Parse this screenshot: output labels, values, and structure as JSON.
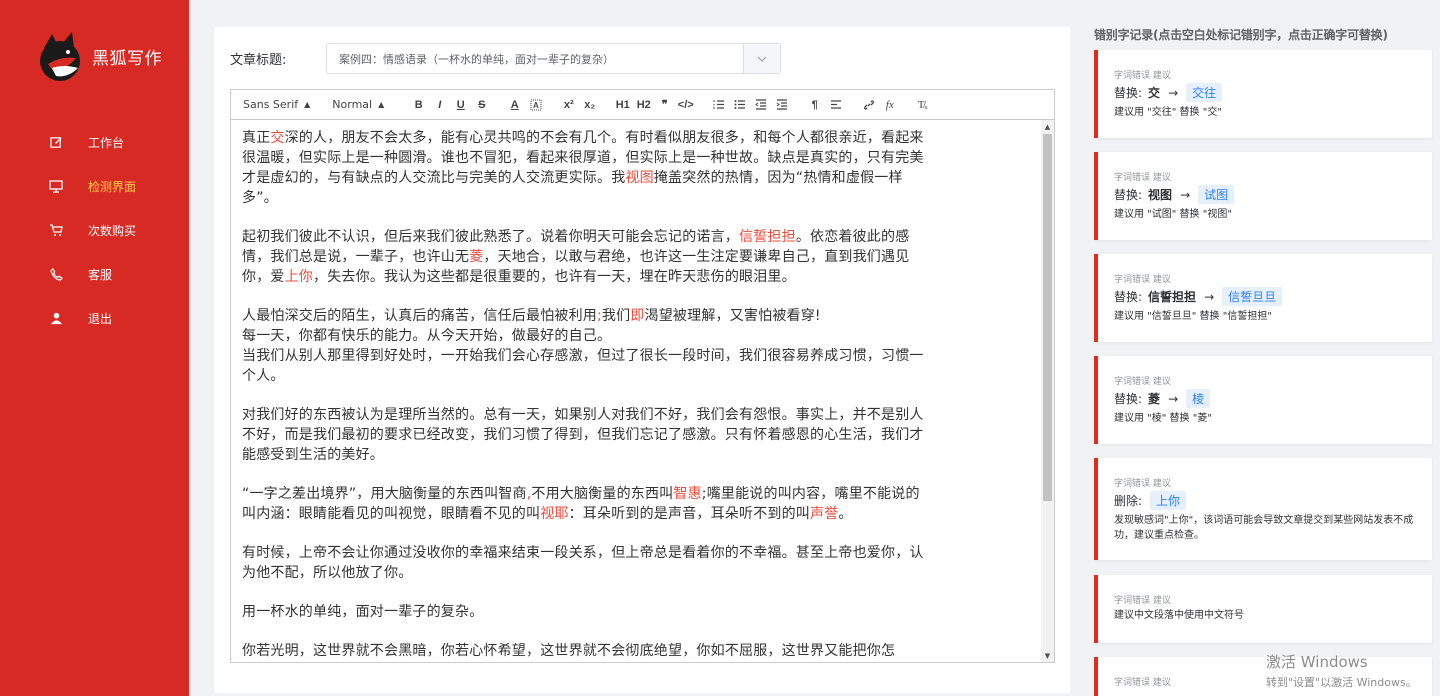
{
  "app": {
    "name": "黑狐写作"
  },
  "nav": [
    {
      "label": "工作台",
      "icon": "edit-icon",
      "active": false
    },
    {
      "label": "检测界面",
      "icon": "monitor-icon",
      "active": true
    },
    {
      "label": "次数购买",
      "icon": "cart-icon",
      "active": false
    },
    {
      "label": "客服",
      "icon": "phone-icon",
      "active": false
    },
    {
      "label": "退出",
      "icon": "user-icon",
      "active": false
    }
  ],
  "article": {
    "title_label": "文章标题:",
    "title_value": "案例四：情感语录（一杯水的单纯，面对一辈子的复杂）"
  },
  "toolbar": {
    "font": "Sans Serif",
    "size": "Normal"
  },
  "editor": {
    "lines": [
      [
        [
          "真正",
          0
        ],
        [
          "交",
          1
        ],
        [
          "深的人，朋友不会太多，能有心灵共鸣的不会有几个。有时看似朋友很多，和每个人都很亲近，看起来",
          0
        ]
      ],
      [
        [
          "很温暖，但实际上是一种圆滑。谁也不冒犯，看起来很厚道，但实际上是一种世故。缺点是真实的，只有完美",
          0
        ]
      ],
      [
        [
          "才是虚幻的，与有缺点的人交流比与完美的人交流更实际。我",
          0
        ],
        [
          "视图",
          1
        ],
        [
          "掩盖突然的热情，因为“热情和虚假一样",
          0
        ]
      ],
      [
        [
          "多”。",
          0
        ]
      ],
      [],
      [
        [
          "起初我们彼此不认识，但后来我们彼此熟悉了。说着你明天可能会忘记的诺言，",
          0
        ],
        [
          "信誓担担",
          1
        ],
        [
          "。依恋着彼此的感",
          0
        ]
      ],
      [
        [
          "情，我们总是说，一辈子，也许山无",
          0
        ],
        [
          "菱",
          1
        ],
        [
          "，天地合，以敢与君绝，也许这一生注定要谦卑自己，直到我们遇见",
          0
        ]
      ],
      [
        [
          "你，爱",
          0
        ],
        [
          "上你",
          1
        ],
        [
          "，失去你。我认为这些都是很重要的，也许有一天，埋在昨天悲伤的眼泪里。",
          0
        ]
      ],
      [],
      [
        [
          "人最怕深交后的陌生，认真后的痛苦，信任后最怕被利用",
          0
        ],
        [
          ";",
          1
        ],
        [
          "我们",
          0
        ],
        [
          "即",
          1
        ],
        [
          "渴望被理解，又害怕被看穿!",
          0
        ]
      ],
      [
        [
          "每一天，你都有快乐的能力。从今天开始，做最好的自己。",
          0
        ]
      ],
      [
        [
          "当我们从别人那里得到好处时，一开始我们会心存感激，但过了很长一段时间，我们很容易养成习惯，习惯一",
          0
        ]
      ],
      [
        [
          "个人。",
          0
        ]
      ],
      [],
      [
        [
          "对我们好的东西被认为是理所当然的。总有一天，如果别人对我们不好，我们会有怨恨。事实上，并不是别人",
          0
        ]
      ],
      [
        [
          "不好，而是我们最初的要求已经改变，我们习惯了得到，但我们忘记了感激。只有怀着感恩的心生活，我们才",
          0
        ]
      ],
      [
        [
          "能感受到生活的美好。",
          0
        ]
      ],
      [],
      [
        [
          "“一字之差出境界”，用大脑衡量的东西叫智商",
          0
        ],
        [
          ",",
          1
        ],
        [
          "不用大脑衡量的东西叫",
          0
        ],
        [
          "智惠",
          1
        ],
        [
          ";嘴里能说的叫内容，嘴里不能说的",
          0
        ]
      ],
      [
        [
          "叫内涵：眼睛能看见的叫视觉，眼睛看不见的叫",
          0
        ],
        [
          "视耶",
          1
        ],
        [
          "：耳朵听到的是声音，耳朵听不到的叫",
          0
        ],
        [
          "声誉",
          1
        ],
        [
          "。",
          0
        ]
      ],
      [],
      [
        [
          "有时候，上帝不会让你通过没收你的幸福来结束一段关系，但上帝总是看着你的不幸福。甚至上帝也爱你，认",
          0
        ]
      ],
      [
        [
          "为他不配，所以他放了你。",
          0
        ]
      ],
      [],
      [
        [
          "用一杯水的单纯，面对一辈子的复杂。",
          0
        ]
      ],
      [],
      [
        [
          "你若光明，这世界就不会黑暗，你若心怀希望，这世界就不会彻底绝望，你如不屈服，这世界又能把你怎",
          0
        ]
      ]
    ]
  },
  "panel": {
    "title": "错别字记录(点击空白处标记错别字，点击正确字可替换)",
    "cards": [
      {
        "type": "字词错误 建议",
        "action": "替换:",
        "orig": "交",
        "suggest": "交往",
        "desc": "建议用 \"交往\" 替换 \"交\""
      },
      {
        "type": "字词错误 建议",
        "action": "替换:",
        "orig": "视图",
        "suggest": "试图",
        "desc": "建议用 \"试图\" 替换 \"视图\""
      },
      {
        "type": "字词错误 建议",
        "action": "替换:",
        "orig": "信誓担担",
        "suggest": "信誓旦旦",
        "desc": "建议用 \"信誓旦旦\" 替换 \"信誓担担\""
      },
      {
        "type": "字词错误 建议",
        "action": "替换:",
        "orig": "菱",
        "suggest": "棱",
        "desc": "建议用 \"棱\" 替换 \"菱\""
      },
      {
        "type": "字词错误 建议",
        "action": "删除:",
        "orig": "",
        "suggest": "上你",
        "desc": "发现敏感词\"上你\"，该词语可能会导致文章提交到某些网站发表不成功，建议重点检查。"
      },
      {
        "type": "字词错误 建议",
        "action": "",
        "orig": "",
        "suggest": "",
        "desc": "建议中文段落中使用中文符号"
      },
      {
        "type": "字词错误 建议",
        "action": "",
        "orig": "",
        "suggest": "",
        "desc": ""
      }
    ]
  },
  "watermark": {
    "line1": "激活 Windows",
    "line2": "转到\"设置\"以激活 Windows。"
  },
  "colors": {
    "sidebar": "#d82a25",
    "active_nav": "#ffd04b",
    "error_text": "#e84c3d",
    "card_border": "#e8271d",
    "tag_bg": "#e6f0fd",
    "tag_text": "#2f80ed"
  }
}
